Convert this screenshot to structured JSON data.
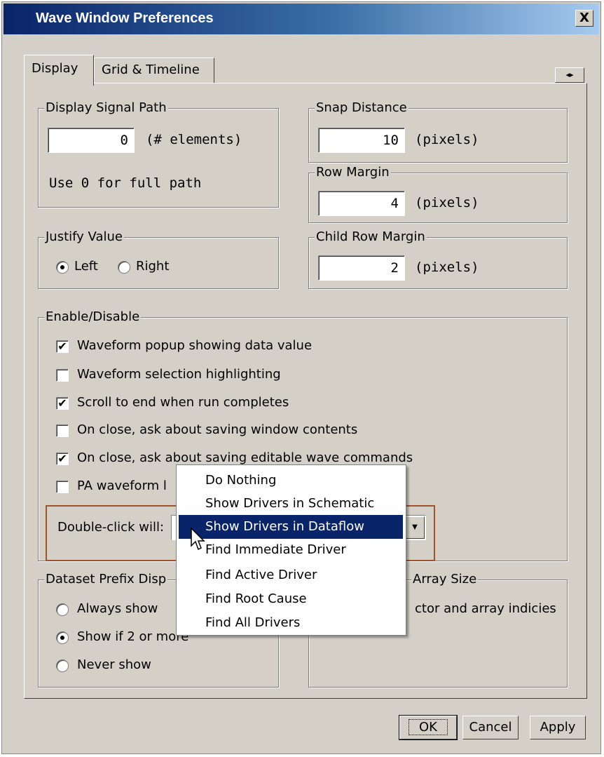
{
  "window": {
    "title": "Wave Window Preferences",
    "close": "X"
  },
  "tabs": [
    {
      "label": "Display"
    },
    {
      "label": "Grid & Timeline"
    }
  ],
  "signal_path": {
    "legend": "Display Signal Path",
    "value": "0",
    "unit": "(# elements)",
    "hint": "Use 0 for full path"
  },
  "snap": {
    "legend": "Snap Distance",
    "value": "10",
    "unit": "(pixels)"
  },
  "row_margin": {
    "legend": "Row Margin",
    "value": "4",
    "unit": "(pixels)"
  },
  "child_row_margin": {
    "legend": "Child Row Margin",
    "value": "2",
    "unit": "(pixels)"
  },
  "justify": {
    "legend": "Justify Value",
    "options": [
      "Left",
      "Right"
    ],
    "selected": "Left"
  },
  "enable": {
    "legend": "Enable/Disable",
    "items": [
      {
        "label": "Waveform popup showing data value",
        "checked": true
      },
      {
        "label": "Waveform selection highlighting",
        "checked": false
      },
      {
        "label": "Scroll to end when run completes",
        "checked": true
      },
      {
        "label": "On close, ask about saving window contents",
        "checked": false
      },
      {
        "label": "On close, ask about saving editable wave commands",
        "checked": true
      },
      {
        "label": "PA waveform l",
        "checked": false
      }
    ],
    "double_click_label": "Double-click will:"
  },
  "dropdown": {
    "options": [
      "Do Nothing",
      "Show Drivers in Schematic",
      "Show Drivers in Dataflow",
      "Find Immediate Driver",
      "Find Active Driver",
      "Find Root Cause",
      "Find All Drivers"
    ],
    "selected": "Show Drivers in Dataflow"
  },
  "dataset": {
    "legend": "Dataset Prefix Disp",
    "options": [
      "Always show",
      "Show if 2 or more",
      "Never show"
    ],
    "selected": "Show if 2 or more"
  },
  "array": {
    "legend": "Array Size",
    "text": "ctor and array indicies"
  },
  "buttons": {
    "ok": "OK",
    "cancel": "Cancel",
    "apply": "Apply"
  },
  "colors": {
    "title_start": "#0a246a",
    "title_end": "#a6caf0",
    "face": "#d4d0c8",
    "selection": "#0a246a",
    "callout": "#a0522d"
  }
}
